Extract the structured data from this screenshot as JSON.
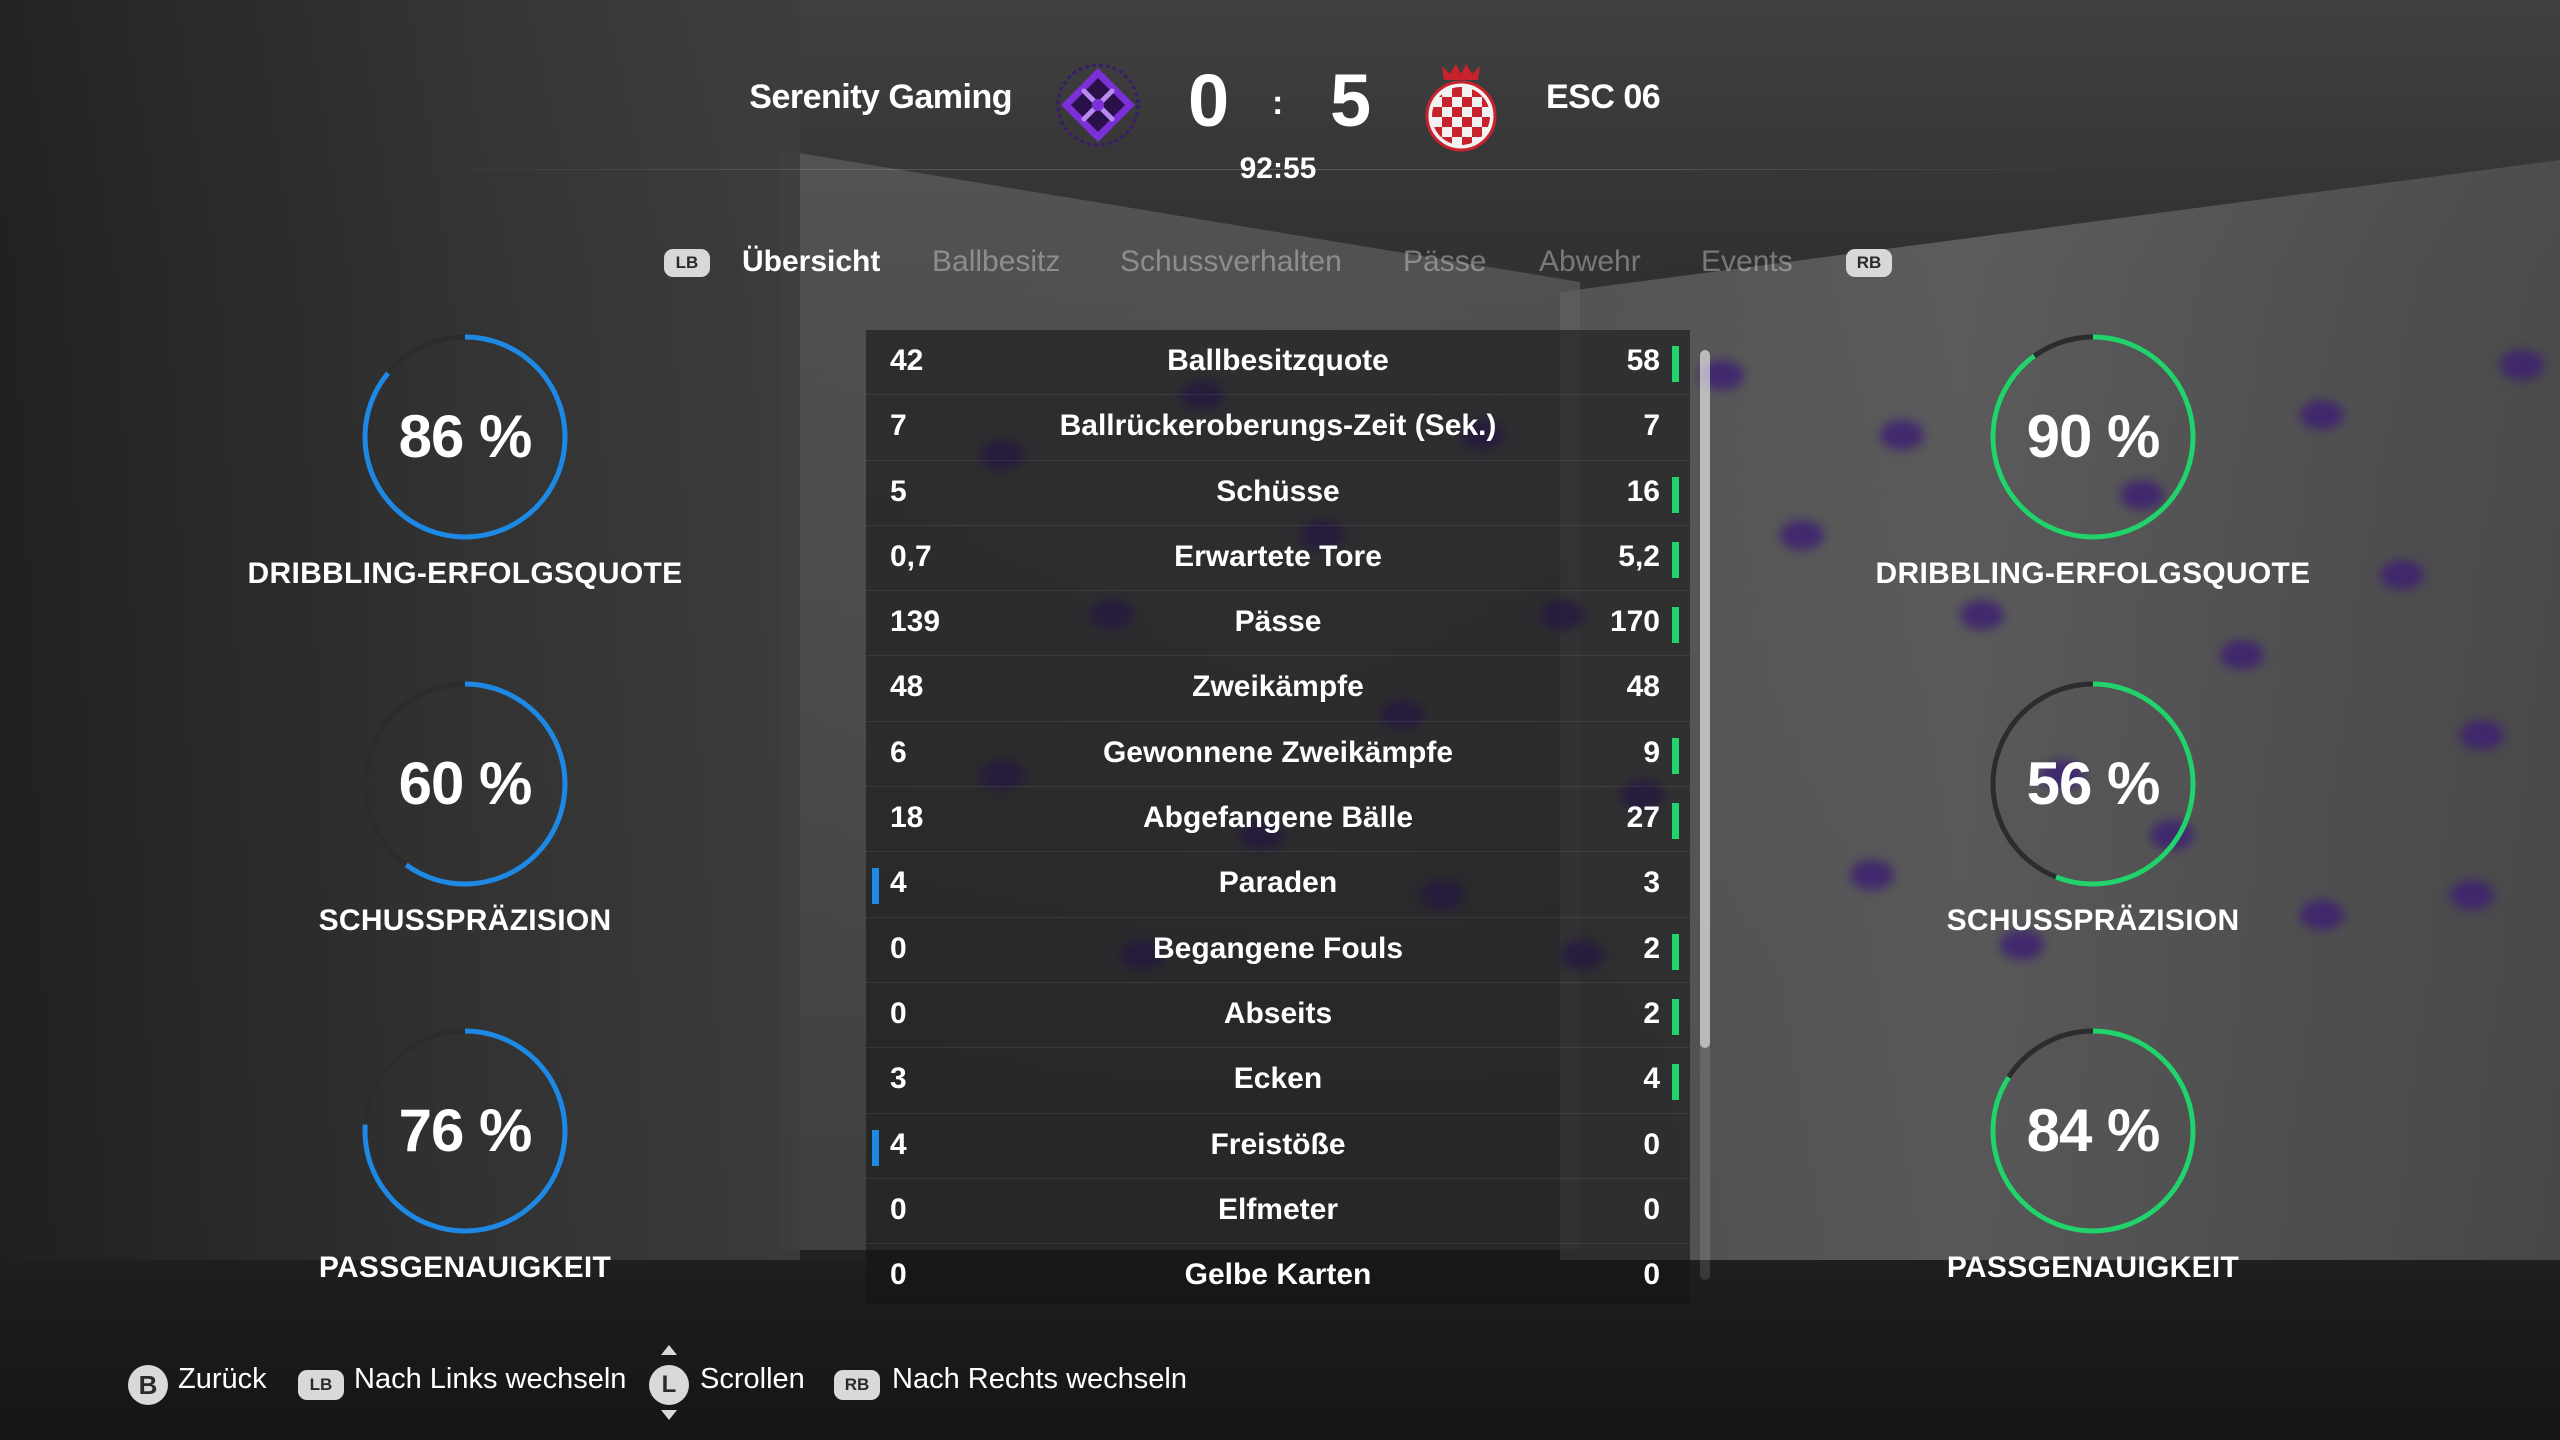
{
  "match": {
    "home_team": "Serenity Gaming",
    "away_team": "ESC 06",
    "home_score": "0",
    "separator": ":",
    "away_score": "5",
    "clock": "92:55"
  },
  "tabs": {
    "left_button": "LB",
    "right_button": "RB",
    "items": [
      "Übersicht",
      "Ballbesitz",
      "Schussverhalten",
      "Pässe",
      "Abwehr",
      "Events"
    ],
    "active_index": 0
  },
  "stats": [
    {
      "name": "Ballbesitzquote",
      "home": "42",
      "away": "58",
      "leader": "away"
    },
    {
      "name": "Ballrückeroberungs-Zeit (Sek.)",
      "home": "7",
      "away": "7",
      "leader": "none"
    },
    {
      "name": "Schüsse",
      "home": "5",
      "away": "16",
      "leader": "away"
    },
    {
      "name": "Erwartete Tore",
      "home": "0,7",
      "away": "5,2",
      "leader": "away"
    },
    {
      "name": "Pässe",
      "home": "139",
      "away": "170",
      "leader": "away"
    },
    {
      "name": "Zweikämpfe",
      "home": "48",
      "away": "48",
      "leader": "none"
    },
    {
      "name": "Gewonnene Zweikämpfe",
      "home": "6",
      "away": "9",
      "leader": "away"
    },
    {
      "name": "Abgefangene Bälle",
      "home": "18",
      "away": "27",
      "leader": "away"
    },
    {
      "name": "Paraden",
      "home": "4",
      "away": "3",
      "leader": "home"
    },
    {
      "name": "Begangene Fouls",
      "home": "0",
      "away": "2",
      "leader": "away"
    },
    {
      "name": "Abseits",
      "home": "0",
      "away": "2",
      "leader": "away"
    },
    {
      "name": "Ecken",
      "home": "3",
      "away": "4",
      "leader": "away"
    },
    {
      "name": "Freistöße",
      "home": "4",
      "away": "0",
      "leader": "home"
    },
    {
      "name": "Elfmeter",
      "home": "0",
      "away": "0",
      "leader": "none"
    },
    {
      "name": "Gelbe Karten",
      "home": "0",
      "away": "0",
      "leader": "none"
    }
  ],
  "scroll_fraction_visible": 0.75,
  "home_gauges": [
    {
      "value": 86,
      "display": "86 %",
      "label": "DRIBBLING-ERFOLGSQUOTE"
    },
    {
      "value": 60,
      "display": "60 %",
      "label": "SCHUSSPRÄZISION"
    },
    {
      "value": 76,
      "display": "76 %",
      "label": "PASSGENAUIGKEIT"
    }
  ],
  "away_gauges": [
    {
      "value": 90,
      "display": "90 %",
      "label": "DRIBBLING-ERFOLGSQUOTE"
    },
    {
      "value": 56,
      "display": "56 %",
      "label": "SCHUSSPRÄZISION"
    },
    {
      "value": 84,
      "display": "84 %",
      "label": "PASSGENAUIGKEIT"
    }
  ],
  "footer": {
    "back_button": "B",
    "back_label": "Zurück",
    "left_button": "LB",
    "left_label": "Nach Links wechseln",
    "scroll_button": "L",
    "scroll_label": "Scrollen",
    "right_button": "RB",
    "right_label": "Nach Rechts wechseln"
  },
  "colors": {
    "home": "#1e88e5",
    "away": "#22d36b",
    "home_crest": "#7b2fd6",
    "away_crest": "#c8232c",
    "track": "#2c2c2e"
  },
  "icons": {
    "home_crest": "serenity-gaming-crest-icon",
    "away_crest": "esc06-crest-icon",
    "scroll_arrows": "stick-up-down-arrows-icon"
  }
}
